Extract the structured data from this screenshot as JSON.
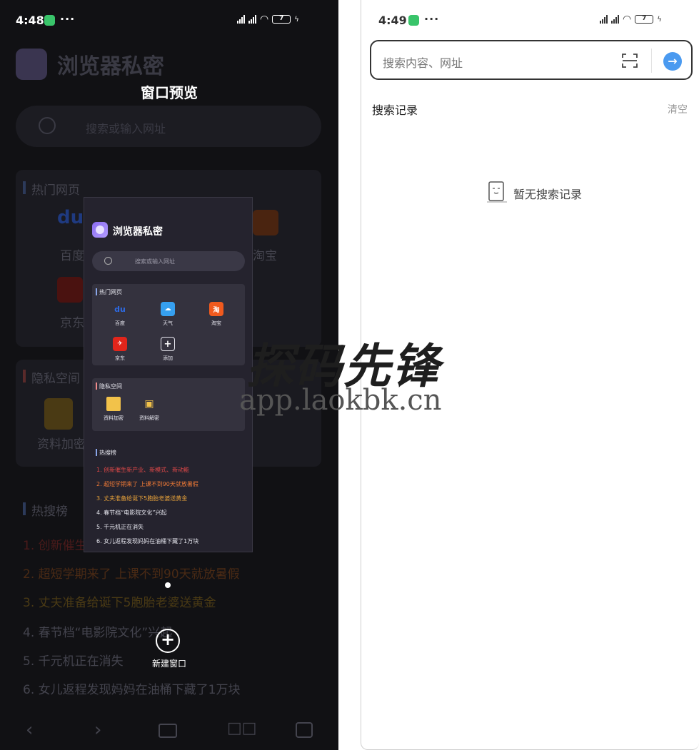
{
  "left": {
    "status_bar": {
      "time": "4:48",
      "battery": "7"
    },
    "preview_title": "窗口预览",
    "background": {
      "app_title": "浏览器私密",
      "search_placeholder": "搜索或输入网址",
      "hot_pages_label": "热门网页",
      "apps": [
        "百度",
        "淘宝",
        "京东"
      ],
      "privacy_label": "隐私空间",
      "privacy_item": "资料加密",
      "trending_label": "热搜榜",
      "trending": [
        "1. 创新催生",
        "2. 超短学期来了 上课不到90天就放暑假",
        "3. 丈夫准备给诞下5胞胎老婆送黄金",
        "4. 春节档“电影院文化”兴起",
        "5. 千元机正在消失",
        "6. 女儿返程发现妈妈在油桶下藏了1万块"
      ]
    },
    "card": {
      "app_title": "浏览器私密",
      "search_placeholder": "搜索或输入网址",
      "hot_pages_label": "热门网页",
      "apps": [
        {
          "label": "百度",
          "glyph": "du",
          "color": "#2d6be6"
        },
        {
          "label": "天气",
          "glyph": "☁",
          "color": "#36a0f0"
        },
        {
          "label": "淘宝",
          "glyph": "淘",
          "color": "#f05a1e"
        },
        {
          "label": "京东",
          "glyph": "✈",
          "color": "#e1251b"
        },
        {
          "label": "添加",
          "glyph": "+",
          "color": "#25232e"
        }
      ],
      "privacy_label": "隐私空间",
      "privacy_items": [
        "资料加密",
        "资料解密"
      ],
      "trending_label": "热搜榜",
      "trending": [
        {
          "text": "1. 创新催生新产业、新模式、新动能",
          "color": "#e04848"
        },
        {
          "text": "2. 超短学期来了 上课不到90天就放暑假",
          "color": "#f07a36"
        },
        {
          "text": "3. 丈夫准备给诞下5胞胎老婆送黄金",
          "color": "#e8a23a"
        },
        {
          "text": "4. 春节档“电影院文化”兴起",
          "color": "#e6e6ee"
        },
        {
          "text": "5. 千元机正在消失",
          "color": "#e6e6ee"
        },
        {
          "text": "6. 女儿返程发现妈妈在油桶下藏了1万块",
          "color": "#e6e6ee"
        }
      ]
    },
    "new_window_label": "新建窗口"
  },
  "right": {
    "status_bar": {
      "time": "4:49",
      "battery": "7"
    },
    "search_placeholder": "搜索内容、网址",
    "history_label": "搜索记录",
    "clear_label": "清空",
    "empty_label": "暂无搜索记录"
  },
  "watermark": {
    "title": "探码先锋",
    "url": "app.laokbk.cn"
  }
}
